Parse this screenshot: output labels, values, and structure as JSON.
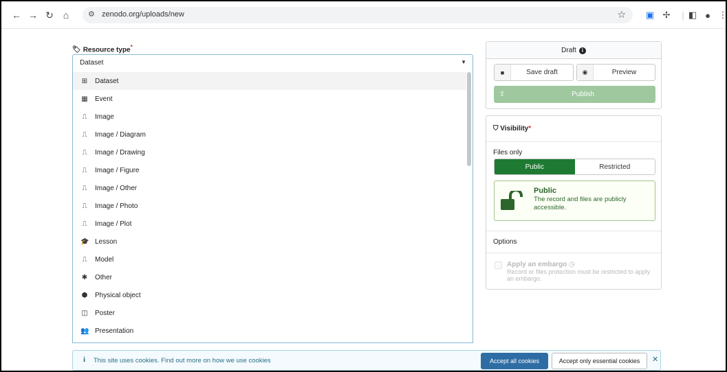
{
  "browser": {
    "url": "zenodo.org/uploads/new"
  },
  "resource_type": {
    "label": "Resource type",
    "required_mark": "*",
    "selected_value": "Dataset",
    "options": [
      {
        "label": "Dataset",
        "icon": "table-icon",
        "glyph": "⊞"
      },
      {
        "label": "Event",
        "icon": "calendar-icon",
        "glyph": "▦"
      },
      {
        "label": "Image",
        "icon": "chart-area-icon",
        "glyph": "⎍"
      },
      {
        "label": "Image / Diagram",
        "icon": "chart-area-icon",
        "glyph": "⎍"
      },
      {
        "label": "Image / Drawing",
        "icon": "chart-area-icon",
        "glyph": "⎍"
      },
      {
        "label": "Image / Figure",
        "icon": "chart-area-icon",
        "glyph": "⎍"
      },
      {
        "label": "Image / Other",
        "icon": "chart-area-icon",
        "glyph": "⎍"
      },
      {
        "label": "Image / Photo",
        "icon": "chart-area-icon",
        "glyph": "⎍"
      },
      {
        "label": "Image / Plot",
        "icon": "chart-area-icon",
        "glyph": "⎍"
      },
      {
        "label": "Lesson",
        "icon": "graduation-cap-icon",
        "glyph": "🎓"
      },
      {
        "label": "Model",
        "icon": "chart-area-icon",
        "glyph": "⎍"
      },
      {
        "label": "Other",
        "icon": "asterisk-icon",
        "glyph": "✱"
      },
      {
        "label": "Physical object",
        "icon": "cube-icon",
        "glyph": "⬢"
      },
      {
        "label": "Poster",
        "icon": "columns-icon",
        "glyph": "◫"
      },
      {
        "label": "Presentation",
        "icon": "users-icon",
        "glyph": "👥"
      }
    ]
  },
  "draft_panel": {
    "title": "Draft",
    "info_glyph": "i",
    "save_label": "Save draft",
    "preview_label": "Preview",
    "publish_label": "Publish"
  },
  "visibility": {
    "title": "Visibility",
    "required_mark": "*",
    "files_only_label": "Files only",
    "public_label": "Public",
    "restricted_label": "Restricted",
    "status_title": "Public",
    "status_desc": "The record and files are publicly accessible.",
    "options_label": "Options",
    "embargo_title": "Apply an embargo",
    "embargo_desc": "Record or files protection must be restricted to apply an embargo."
  },
  "cookie_bar": {
    "text": "This site uses cookies. Find out more on how we use cookies",
    "accept_all_label": "Accept all cookies",
    "accept_essential_label": "Accept only essential cookies"
  },
  "colors": {
    "primary_green": "#1e7a32",
    "publish_disabled": "#9fc89f",
    "cookie_blue": "#2e6da4",
    "required_red": "#db2828"
  }
}
